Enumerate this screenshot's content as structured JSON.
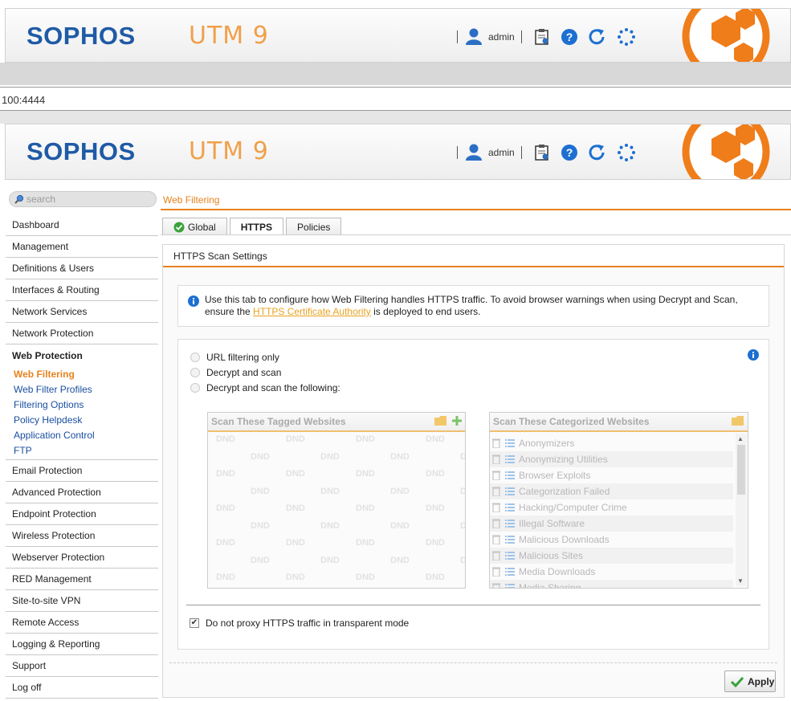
{
  "brand": {
    "logo": "SOPHOS",
    "product": "UTM 9",
    "accent": "#e8821e",
    "logo_color": "#1f5aa6"
  },
  "header": {
    "user": "admin",
    "icons": [
      "user-icon",
      "clipboard-icon",
      "help-icon",
      "reload-icon",
      "spinner-icon"
    ]
  },
  "url_bar": {
    "text": "100:4444"
  },
  "sidebar": {
    "search_placeholder": "search",
    "items_before": [
      "Dashboard",
      "Management",
      "Definitions & Users",
      "Interfaces & Routing",
      "Network Services",
      "Network Protection"
    ],
    "active_section": "Web Protection",
    "sub_items": [
      "Web Filtering",
      "Web Filter Profiles",
      "Filtering Options",
      "Policy Helpdesk",
      "Application Control",
      "FTP"
    ],
    "items_after": [
      "Email Protection",
      "Advanced Protection",
      "Endpoint Protection",
      "Wireless Protection",
      "Webserver Protection",
      "RED Management",
      "Site-to-site VPN",
      "Remote Access",
      "Logging & Reporting",
      "Support",
      "Log off"
    ]
  },
  "breadcrumb": "Web Filtering",
  "tabs": [
    "Global",
    "HTTPS",
    "Policies"
  ],
  "panel": {
    "title": "HTTPS Scan Settings",
    "info_before": "Use this tab to configure how Web Filtering handles HTTPS traffic. To avoid browser warnings when using Decrypt and Scan, ensure the ",
    "info_link": "HTTPS Certificate Authority",
    "info_after": " is deployed to end users.",
    "radio_options": [
      "URL filtering only",
      "Decrypt and scan",
      "Decrypt and scan the following:"
    ],
    "tagged_box_title": "Scan These Tagged Websites",
    "dnd_label": "DND",
    "categorized_box_title": "Scan These Categorized Websites",
    "categories": [
      "Anonymizers",
      "Anonymizing Utilities",
      "Browser Exploits",
      "Categorization Failed",
      "Hacking/Computer Crime",
      "Illegal Software",
      "Malicious Downloads",
      "Malicious Sites",
      "Media Downloads",
      "Media Sharing"
    ],
    "checkbox_label": "Do not proxy HTTPS traffic in transparent mode",
    "checkbox_checked": true,
    "apply_label": "Apply"
  }
}
